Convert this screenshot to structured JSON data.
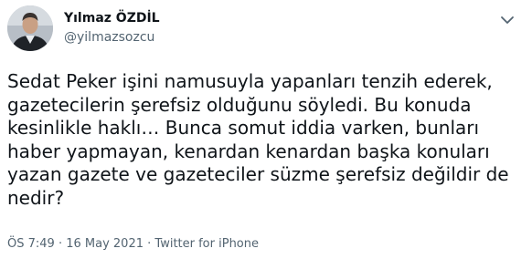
{
  "author": {
    "name": "Yılmaz ÖZDİL",
    "handle": "@yilmazsozcu",
    "avatar_icon": "profile-photo",
    "more_icon": "chevron-down-icon"
  },
  "tweet": {
    "text": "Sedat Peker işini namusuyla yapanları tenzih ederek,\ngazetecilerin şerefsiz olduğunu söyledi. Bu konuda\nkesinlikle haklı… Bunca somut iddia varken, bunları\nhaber yapmayan, kenardan kenardan başka konuları\nyazan gazete ve gazeteciler süzme şerefsiz değildir de\nnedir?"
  },
  "meta": {
    "time": "ÖS 7:49",
    "separator": " · ",
    "date": "16 May 2021",
    "source": "Twitter for iPhone"
  },
  "colors": {
    "text": "#0f1419",
    "secondary": "#536471",
    "background": "#ffffff"
  }
}
